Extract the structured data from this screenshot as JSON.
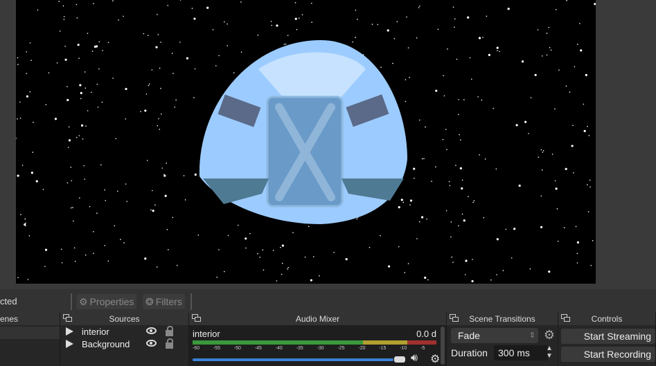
{
  "toolbar": {
    "selection_label": "cted",
    "properties_label": "Properties",
    "filters_label": "Filters"
  },
  "docks": {
    "scenes": {
      "title": "enes"
    },
    "sources": {
      "title": "Sources",
      "items": [
        {
          "name": "interior",
          "visible": true,
          "locked": false
        },
        {
          "name": "Background",
          "visible": true,
          "locked": false
        }
      ]
    },
    "audio_mixer": {
      "title": "Audio Mixer",
      "channel": "interior",
      "level": "0.0 d",
      "volume_fraction": 0.97,
      "ticks": [
        "-60",
        "-55",
        "-50",
        "-45",
        "-40",
        "-35",
        "-30",
        "-25",
        "-20",
        "-15",
        "-10",
        "-5"
      ]
    },
    "scene_transitions": {
      "title": "Scene Transitions",
      "transition": "Fade",
      "duration_label": "Duration",
      "duration_value": "300 ms"
    },
    "controls": {
      "title": "Controls",
      "start_streaming": "Start Streaming",
      "start_recording": "Start Recording"
    }
  },
  "colors": {
    "meter_green": "#3a9a3a",
    "meter_yellow": "#b0a030",
    "meter_red": "#a03030",
    "volume_blue": "#3a82d6"
  }
}
